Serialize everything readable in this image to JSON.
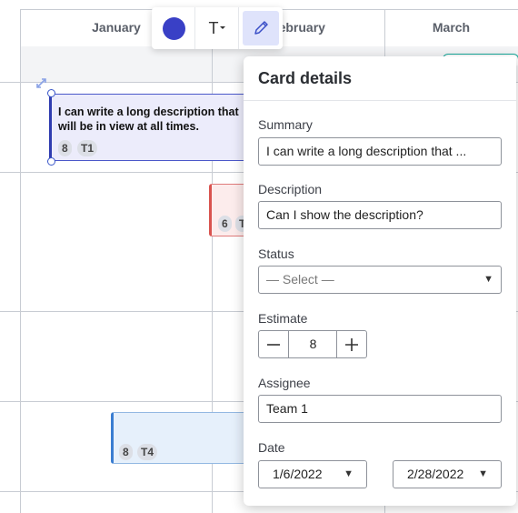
{
  "timeline": {
    "months": [
      "January",
      "February",
      "March"
    ]
  },
  "cards": [
    {
      "text": "I can write a long description that will be in view at all times.",
      "estimate": "8",
      "team": "T1",
      "color": "#2f3cb0"
    },
    {
      "text": "",
      "estimate": "6",
      "team": "T",
      "color": "#d9534f"
    },
    {
      "text": "",
      "estimate": "8",
      "team": "T4",
      "color": "#3a7dd1"
    }
  ],
  "toolbar": {
    "color_value": "#3940c6",
    "text_label": "T",
    "icons": [
      "color-swatch-icon",
      "text-format-icon",
      "pencil-icon"
    ]
  },
  "panel": {
    "title": "Card details",
    "summary_label": "Summary",
    "summary_value": "I can write a long description that ...",
    "description_label": "Description",
    "description_value": "Can I show the description?",
    "status_label": "Status",
    "status_value": "— Select —",
    "estimate_label": "Estimate",
    "estimate_value": "8",
    "assignee_label": "Assignee",
    "assignee_value": "Team 1",
    "date_label": "Date",
    "date_start": "1/6/2022",
    "date_end": "2/28/2022"
  }
}
